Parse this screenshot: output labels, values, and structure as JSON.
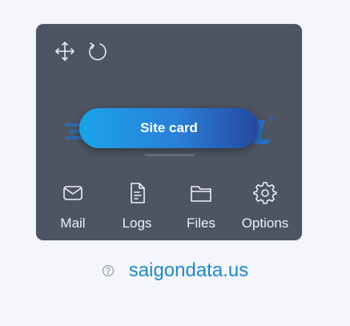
{
  "card": {
    "toolbar_icons": [
      "move-icon",
      "refresh-icon"
    ],
    "logo_text": "saigondata.us",
    "button_label": "Site card",
    "actions": [
      {
        "label": "Mail",
        "icon": "mail-icon"
      },
      {
        "label": "Logs",
        "icon": "document-icon"
      },
      {
        "label": "Files",
        "icon": "folder-icon"
      },
      {
        "label": "Options",
        "icon": "gear-icon"
      }
    ]
  },
  "domain": {
    "help_icon": "help-icon",
    "text": "saigondata.us"
  },
  "colors": {
    "card_bg": "#4d5462",
    "page_bg": "#f4f6fb",
    "button_gradient_start": "#1aa4e8",
    "button_gradient_end": "#23489d",
    "link": "#1e8ac9"
  }
}
